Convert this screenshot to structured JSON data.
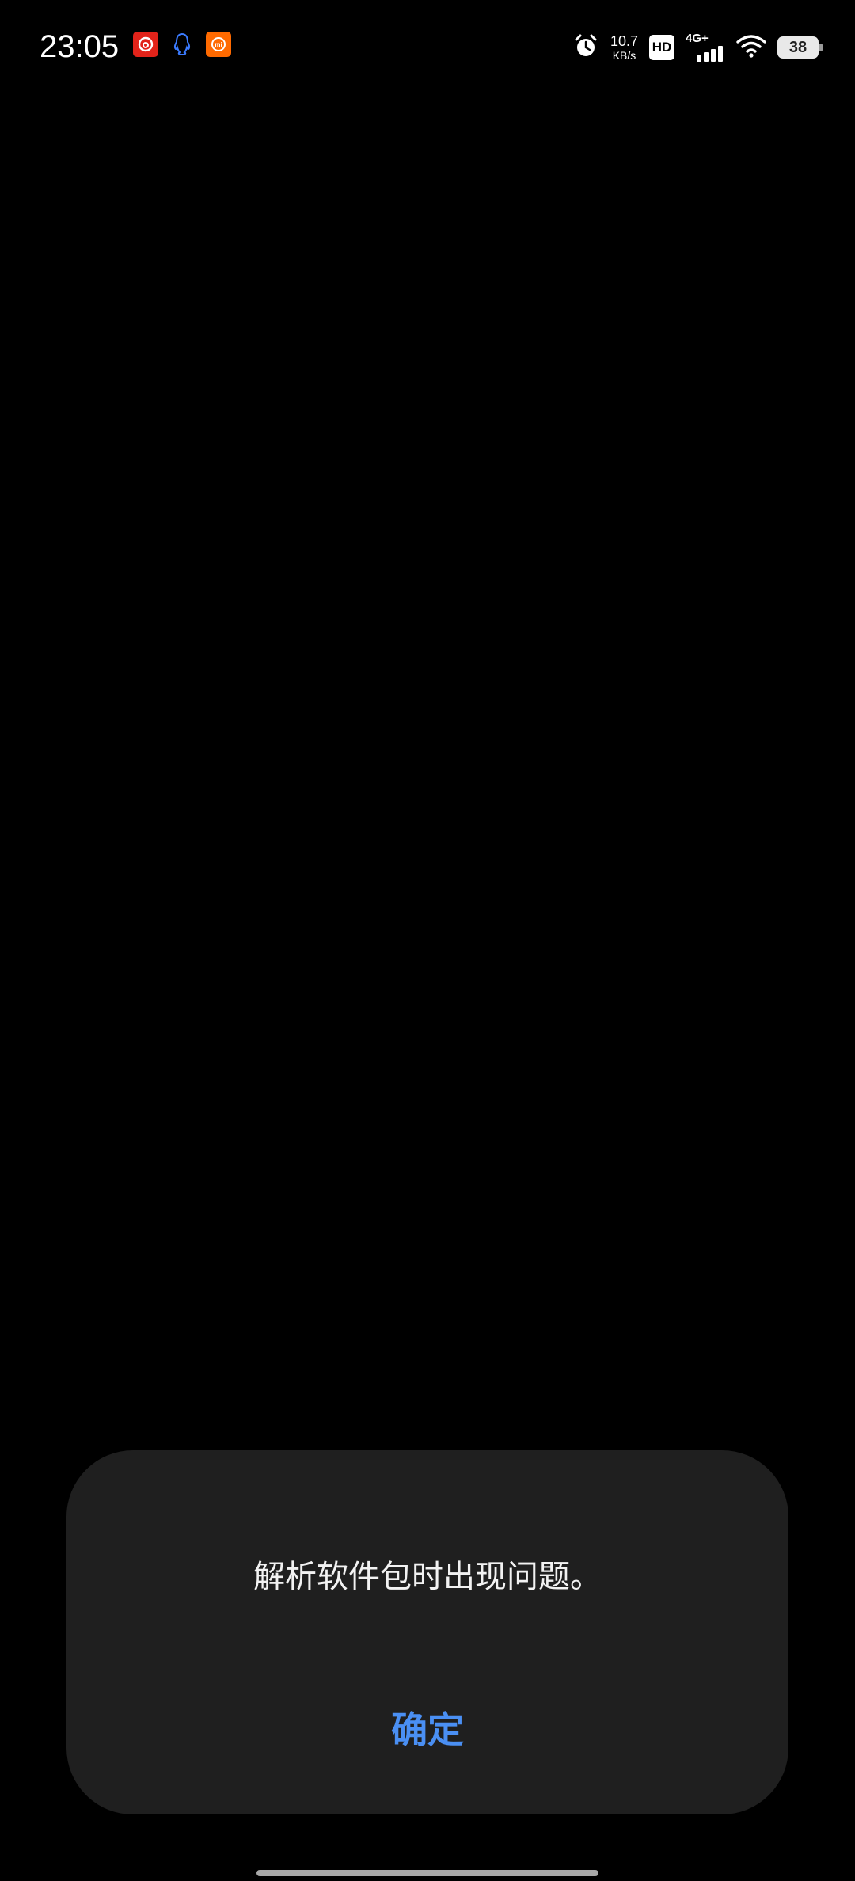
{
  "status_bar": {
    "time": "23:05",
    "notification_icons": [
      "netease-music-icon",
      "qq-icon",
      "mi-app-icon"
    ],
    "network_speed_value": "10.7",
    "network_speed_unit": "KB/s",
    "hd_label": "HD",
    "network_type": "4G+",
    "battery_level": "38"
  },
  "dialog": {
    "message": "解析软件包时出现问题。",
    "confirm_label": "确定"
  },
  "colors": {
    "background": "#000000",
    "dialog_background": "#1f1f1f",
    "accent": "#4a8ff3"
  }
}
